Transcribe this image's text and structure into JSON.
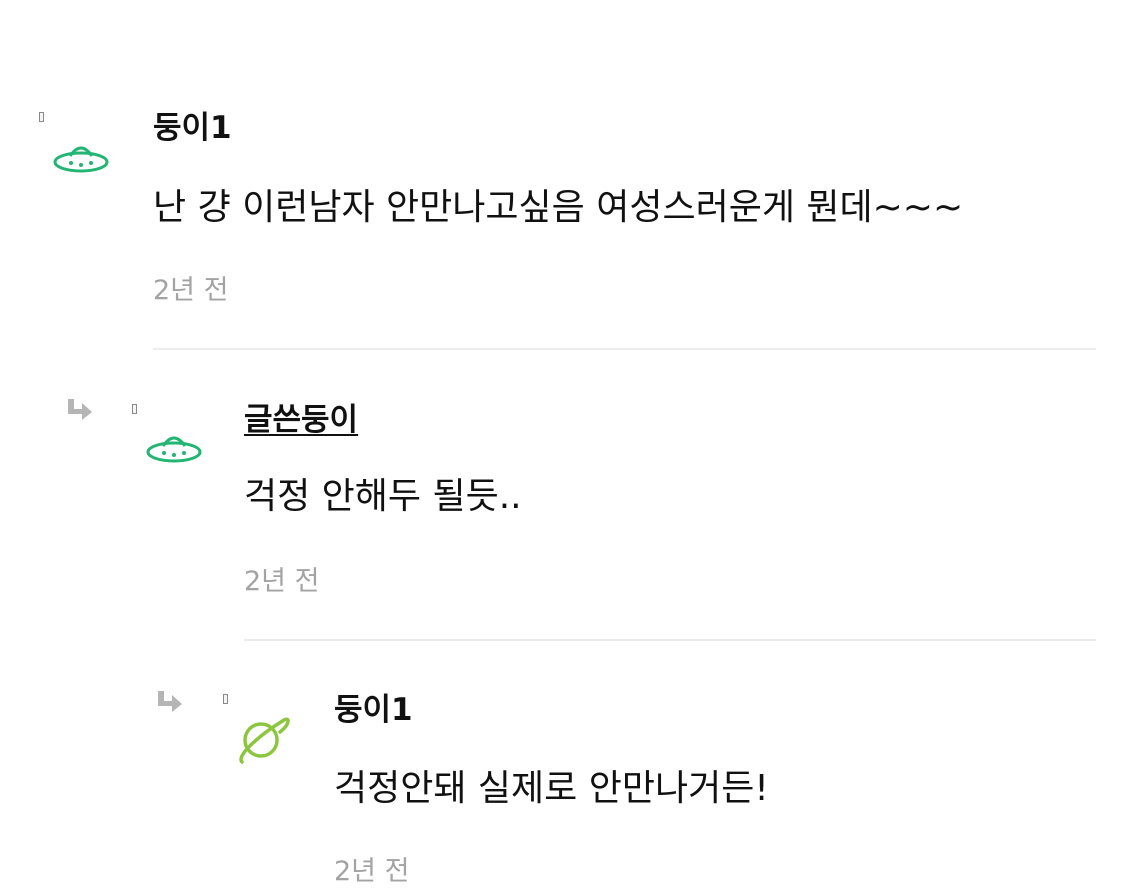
{
  "comments": [
    {
      "author": "둥이1",
      "text": "난 걍 이런남자 안만나고싶음 여성스러운게 뭔데~~~",
      "time": "2년 전",
      "avatar_icon": "ufo-icon",
      "avatar_color": "#22b573"
    },
    {
      "author": "글쓴둥이",
      "text": "걱정 안해두 될듯..",
      "time": "2년 전",
      "avatar_icon": "ufo-icon",
      "avatar_color": "#22b573"
    },
    {
      "author": "둥이1",
      "text": "걱정안돼 실제로 안만나거든!",
      "time": "2년 전",
      "avatar_icon": "planet-icon",
      "avatar_color": "#8cc63f"
    }
  ],
  "colors": {
    "text": "#111111",
    "time": "#a3a3a3",
    "divider": "#ececec",
    "reply_arrow": "#b5b5b5"
  },
  "icons": {
    "reply": "reply-arrow-icon",
    "broken_image": "broken-image-icon"
  }
}
